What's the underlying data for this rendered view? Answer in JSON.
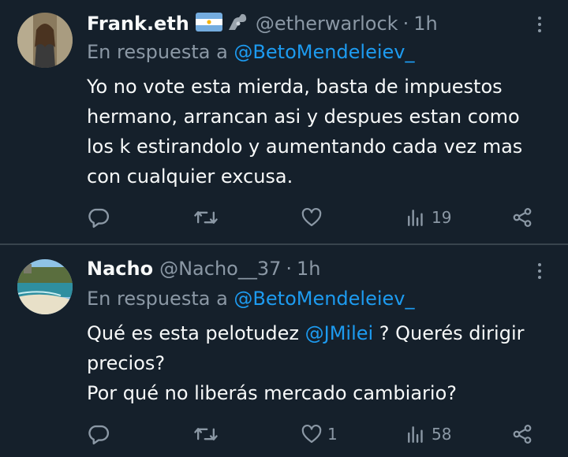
{
  "tweets": [
    {
      "name": "Frank.eth",
      "badges": [
        "argentina-flag",
        "mechanical-arm"
      ],
      "handle": "@etherwarlock",
      "separator": "·",
      "time": "1h",
      "reply_prefix": "En respuesta a",
      "reply_to": "@BetoMendeleiev_",
      "body_lines": [
        "Yo no vote esta mierda, basta de impuestos",
        "hermano, arrancan asi y despues estan como",
        "los k estirandolo y aumentando cada vez mas",
        "con cualquier excusa."
      ],
      "likes": "",
      "views": "19"
    },
    {
      "name": "Nacho",
      "handle": "@Nacho__37",
      "separator": "·",
      "time": "1h",
      "reply_prefix": "En respuesta a",
      "reply_to": "@BetoMendeleiev_",
      "body": {
        "line1_before": "Qué es esta pelotudez ",
        "line1_mention": "@JMilei",
        "line1_after": " ? Querés dirigir",
        "line2": "precios?",
        "line3": "Por qué no liberás mercado cambiario?"
      },
      "likes": "1",
      "views": "58"
    }
  ],
  "colors": {
    "background": "#15202b",
    "text": "#f7f9f9",
    "secondary": "#8b98a5",
    "accent": "#1d9bf0",
    "divider": "#38444d"
  },
  "icons": [
    "reply-icon",
    "retweet-icon",
    "like-icon",
    "views-icon",
    "share-icon",
    "more-icon"
  ]
}
